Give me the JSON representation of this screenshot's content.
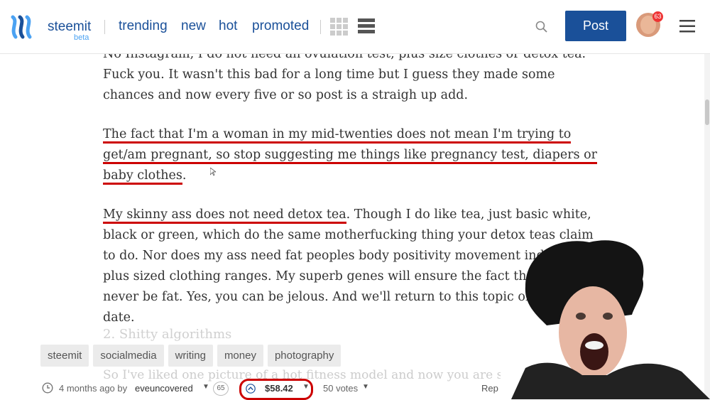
{
  "header": {
    "brand": "steemit",
    "beta": "beta",
    "nav": [
      "trending",
      "new",
      "hot",
      "promoted"
    ],
    "post_label": "Post",
    "notification_count": "63"
  },
  "article": {
    "paragraph1": "No Instagram, I do not need an ovulation test, plus size clothes or detox tea. Fuck you. It wasn't this bad for a long time but I guess they made some chances and now every five or so post is a straigh up add.",
    "paragraph2_highlight": "The fact that I'm a woman in my mid-twenties does not mean I'm trying to get/am pregnant, so stop suggesting me things like pregnancy test, diapers or baby clothes",
    "paragraph2_end": ".",
    "paragraph3_highlight": "My skinny ass does not need detox tea",
    "paragraph3_rest": ". Though I do like tea, just basic white, black or green, which do the same motherfucking thing your detox teas claim to do. Nor does my ass need fat peoples body positivity movement induced plus sized clothing ranges. My superb genes will ensure the fact that I will never be fat. Yes, you can be jelous. And we'll return to this topic on a later date.",
    "heading": "2. Shitty algorithms",
    "faint_line": "So I've liked one picture of a hot fitness model and now you are showing me"
  },
  "tags": [
    "steemit",
    "socialmedia",
    "writing",
    "money",
    "photography"
  ],
  "meta": {
    "time": "4 months ago by",
    "author": "eveuncovered",
    "reputation": "65",
    "payout": "$58.42",
    "votes": "50 votes",
    "reply": "Rep"
  },
  "colors": {
    "brand": "#1a5099",
    "highlight": "#cc0000"
  }
}
